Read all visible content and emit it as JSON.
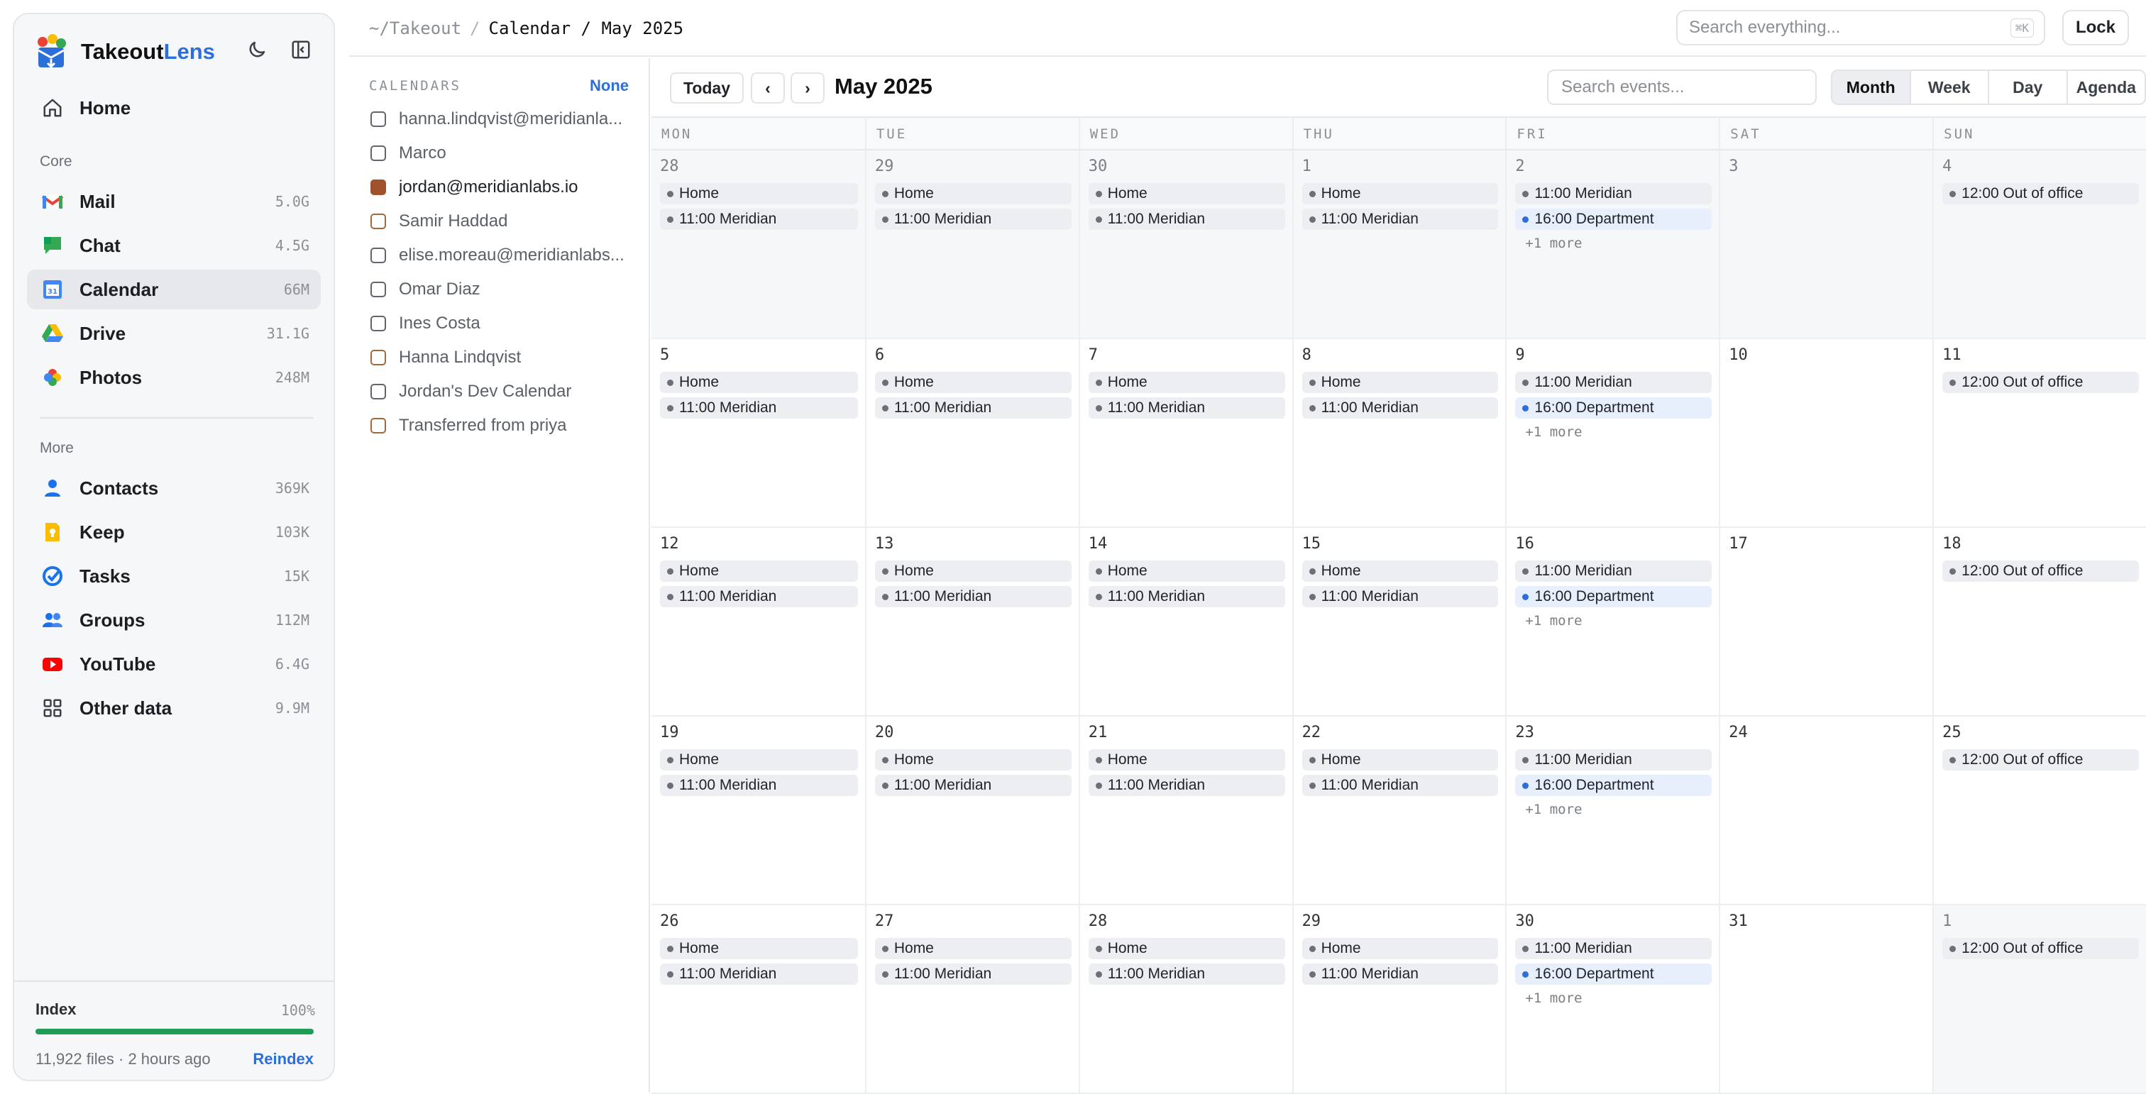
{
  "app": {
    "name_main": "Takeout",
    "name_accent": "Lens"
  },
  "nav": {
    "home": "Home",
    "core_label": "Core",
    "core": [
      {
        "label": "Mail",
        "size": "5.0G",
        "icon": "gmail-icon"
      },
      {
        "label": "Chat",
        "size": "4.5G",
        "icon": "chat-icon"
      },
      {
        "label": "Calendar",
        "size": "66M",
        "icon": "calendar-icon"
      },
      {
        "label": "Drive",
        "size": "31.1G",
        "icon": "drive-icon"
      },
      {
        "label": "Photos",
        "size": "248M",
        "icon": "photos-icon"
      }
    ],
    "more_label": "More",
    "more": [
      {
        "label": "Contacts",
        "size": "369K",
        "icon": "contacts-icon"
      },
      {
        "label": "Keep",
        "size": "103K",
        "icon": "keep-icon"
      },
      {
        "label": "Tasks",
        "size": "15K",
        "icon": "tasks-icon"
      },
      {
        "label": "Groups",
        "size": "112M",
        "icon": "groups-icon"
      },
      {
        "label": "YouTube",
        "size": "6.4G",
        "icon": "youtube-icon"
      },
      {
        "label": "Other data",
        "size": "9.9M",
        "icon": "grid-icon"
      }
    ]
  },
  "index": {
    "title": "Index",
    "percent": "100%",
    "progress": 1.0,
    "meta": "11,922 files · 2 hours ago",
    "reindex": "Reindex"
  },
  "breadcrumb": {
    "root": "~/Takeout",
    "sep": "/",
    "current": "Calendar / May 2025"
  },
  "search": {
    "placeholder": "Search everything...",
    "shortcut": "⌘K"
  },
  "lock": "Lock",
  "calendars": {
    "heading": "CALENDARS",
    "none": "None",
    "items": [
      {
        "name": "hanna.lindqvist@meridianla...",
        "color": "#5f656d",
        "checked": false
      },
      {
        "name": "Marco",
        "color": "#5f656d",
        "checked": false
      },
      {
        "name": "jordan@meridianlabs.io",
        "color": "#a0522d",
        "checked": true
      },
      {
        "name": "Samir Haddad",
        "color": "#a0693d",
        "checked": false
      },
      {
        "name": "elise.moreau@meridianlabs...",
        "color": "#5f656d",
        "checked": false
      },
      {
        "name": "Omar Diaz",
        "color": "#5f656d",
        "checked": false
      },
      {
        "name": "Ines Costa",
        "color": "#5f656d",
        "checked": false
      },
      {
        "name": "Hanna Lindqvist",
        "color": "#a0693d",
        "checked": false
      },
      {
        "name": "Jordan's Dev Calendar",
        "color": "#5f656d",
        "checked": false
      },
      {
        "name": "Transferred from priya",
        "color": "#a0693d",
        "checked": false
      }
    ]
  },
  "toolbar": {
    "today": "Today",
    "prev": "‹",
    "next": "›",
    "title": "May 2025",
    "search_placeholder": "Search events...",
    "views": [
      "Month",
      "Week",
      "Day",
      "Agenda"
    ],
    "active_view": "Month"
  },
  "weekdays": [
    "MON",
    "TUE",
    "WED",
    "THU",
    "FRI",
    "SAT",
    "SUN"
  ],
  "weeks": [
    [
      {
        "day": "28",
        "out": true,
        "events": [
          {
            "t": "Home"
          },
          {
            "t": "11:00 Meridian"
          }
        ]
      },
      {
        "day": "29",
        "out": true,
        "events": [
          {
            "t": "Home"
          },
          {
            "t": "11:00 Meridian"
          }
        ]
      },
      {
        "day": "30",
        "out": true,
        "events": [
          {
            "t": "Home"
          },
          {
            "t": "11:00 Meridian"
          }
        ]
      },
      {
        "day": "1",
        "out": true,
        "events": [
          {
            "t": "Home"
          },
          {
            "t": "11:00 Meridian"
          }
        ]
      },
      {
        "day": "2",
        "out": true,
        "events": [
          {
            "t": "11:00 Meridian"
          },
          {
            "t": "16:00 Department",
            "dept": true
          }
        ],
        "more": "+1 more"
      },
      {
        "day": "3",
        "out": true,
        "events": []
      },
      {
        "day": "4",
        "out": true,
        "events": [
          {
            "t": "12:00 Out of office"
          }
        ]
      }
    ],
    [
      {
        "day": "5",
        "events": [
          {
            "t": "Home"
          },
          {
            "t": "11:00 Meridian"
          }
        ]
      },
      {
        "day": "6",
        "events": [
          {
            "t": "Home"
          },
          {
            "t": "11:00 Meridian"
          }
        ]
      },
      {
        "day": "7",
        "events": [
          {
            "t": "Home"
          },
          {
            "t": "11:00 Meridian"
          }
        ]
      },
      {
        "day": "8",
        "events": [
          {
            "t": "Home"
          },
          {
            "t": "11:00 Meridian"
          }
        ]
      },
      {
        "day": "9",
        "events": [
          {
            "t": "11:00 Meridian"
          },
          {
            "t": "16:00 Department",
            "dept": true
          }
        ],
        "more": "+1 more"
      },
      {
        "day": "10",
        "events": []
      },
      {
        "day": "11",
        "events": [
          {
            "t": "12:00 Out of office"
          }
        ]
      }
    ],
    [
      {
        "day": "12",
        "events": [
          {
            "t": "Home"
          },
          {
            "t": "11:00 Meridian"
          }
        ]
      },
      {
        "day": "13",
        "events": [
          {
            "t": "Home"
          },
          {
            "t": "11:00 Meridian"
          }
        ]
      },
      {
        "day": "14",
        "events": [
          {
            "t": "Home"
          },
          {
            "t": "11:00 Meridian"
          }
        ]
      },
      {
        "day": "15",
        "events": [
          {
            "t": "Home"
          },
          {
            "t": "11:00 Meridian"
          }
        ]
      },
      {
        "day": "16",
        "events": [
          {
            "t": "11:00 Meridian"
          },
          {
            "t": "16:00 Department",
            "dept": true
          }
        ],
        "more": "+1 more"
      },
      {
        "day": "17",
        "events": []
      },
      {
        "day": "18",
        "events": [
          {
            "t": "12:00 Out of office"
          }
        ]
      }
    ],
    [
      {
        "day": "19",
        "events": [
          {
            "t": "Home"
          },
          {
            "t": "11:00 Meridian"
          }
        ]
      },
      {
        "day": "20",
        "events": [
          {
            "t": "Home"
          },
          {
            "t": "11:00 Meridian"
          }
        ]
      },
      {
        "day": "21",
        "events": [
          {
            "t": "Home"
          },
          {
            "t": "11:00 Meridian"
          }
        ]
      },
      {
        "day": "22",
        "events": [
          {
            "t": "Home"
          },
          {
            "t": "11:00 Meridian"
          }
        ]
      },
      {
        "day": "23",
        "events": [
          {
            "t": "11:00 Meridian"
          },
          {
            "t": "16:00 Department",
            "dept": true
          }
        ],
        "more": "+1 more"
      },
      {
        "day": "24",
        "events": []
      },
      {
        "day": "25",
        "events": [
          {
            "t": "12:00 Out of office"
          }
        ]
      }
    ],
    [
      {
        "day": "26",
        "events": [
          {
            "t": "Home"
          },
          {
            "t": "11:00 Meridian"
          }
        ]
      },
      {
        "day": "27",
        "events": [
          {
            "t": "Home"
          },
          {
            "t": "11:00 Meridian"
          }
        ]
      },
      {
        "day": "28",
        "events": [
          {
            "t": "Home"
          },
          {
            "t": "11:00 Meridian"
          }
        ]
      },
      {
        "day": "29",
        "events": [
          {
            "t": "Home"
          },
          {
            "t": "11:00 Meridian"
          }
        ]
      },
      {
        "day": "30",
        "events": [
          {
            "t": "11:00 Meridian"
          },
          {
            "t": "16:00 Department",
            "dept": true
          }
        ],
        "more": "+1 more"
      },
      {
        "day": "31",
        "events": []
      },
      {
        "day": "1",
        "out": true,
        "events": [
          {
            "t": "12:00 Out of office"
          }
        ]
      }
    ]
  ]
}
